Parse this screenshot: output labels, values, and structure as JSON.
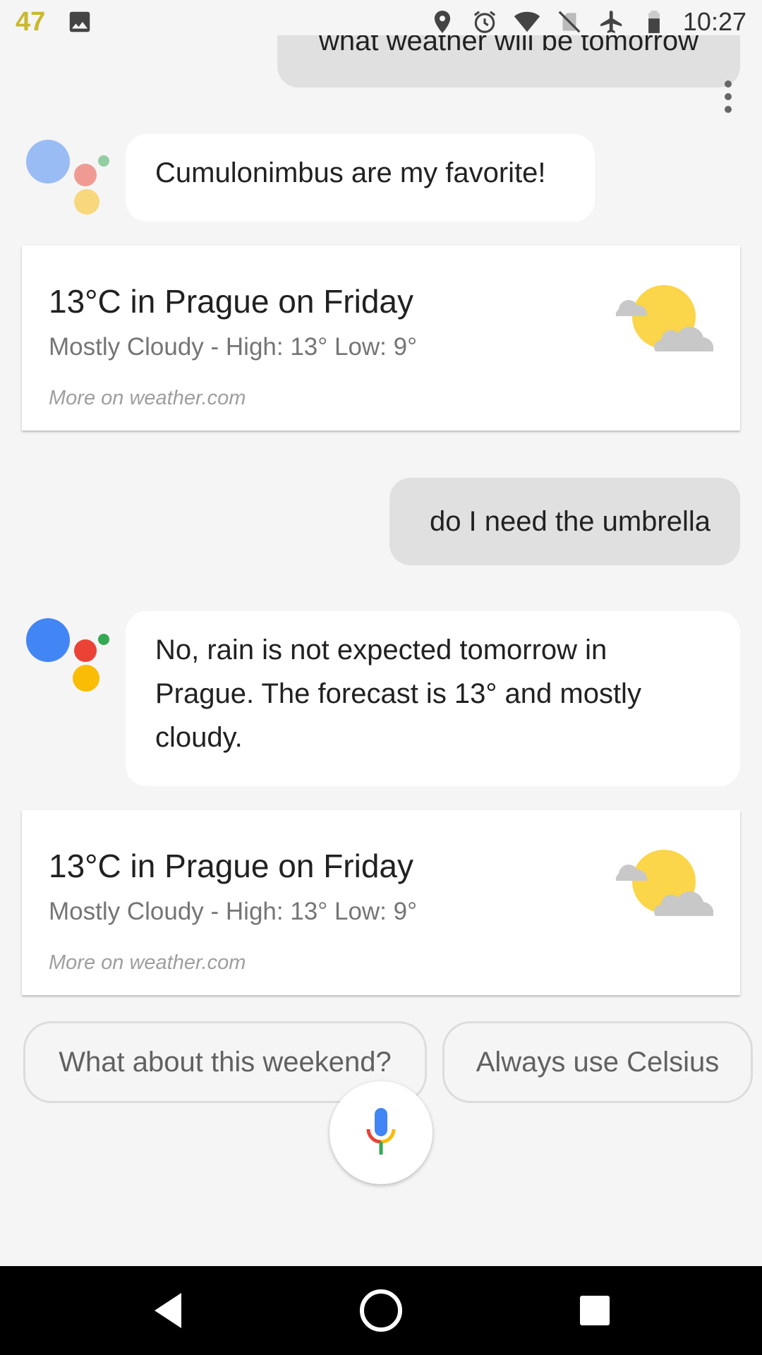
{
  "status_bar": {
    "notification_count": "47",
    "time": "10:27",
    "icons": [
      "image-icon",
      "location-icon",
      "alarm-icon",
      "wifi-icon",
      "no-sim-icon",
      "airplane-icon",
      "battery-icon"
    ]
  },
  "conversation": {
    "user_message_1": "what weather will be tomorrow",
    "assistant_message_1": "Cumulonimbus are my favorite!",
    "weather_card_1": {
      "title": "13°C in Prague on Friday",
      "subtitle": "Mostly Cloudy - High: 13° Low: 9°",
      "link": "More on weather.com",
      "icon": "partly-cloudy-icon"
    },
    "user_message_2": "do I need the umbrella",
    "assistant_message_2": "No, rain is not expected tomorrow in Prague. The forecast is 13° and mostly cloudy.",
    "weather_card_2": {
      "title": "13°C in Prague on Friday",
      "subtitle": "Mostly Cloudy - High: 13° Low: 9°",
      "link": "More on weather.com",
      "icon": "partly-cloudy-icon"
    }
  },
  "suggestions": [
    "What about this weekend?",
    "Always use Celsius"
  ],
  "colors": {
    "google_blue": "#4285f4",
    "google_red": "#ea4335",
    "google_yellow": "#fbbc05",
    "google_green": "#34a853",
    "user_bubble": "#e0e0e0",
    "background": "#f5f5f5"
  },
  "nav_bar": {
    "buttons": [
      "back-icon",
      "home-icon",
      "recents-icon"
    ]
  }
}
